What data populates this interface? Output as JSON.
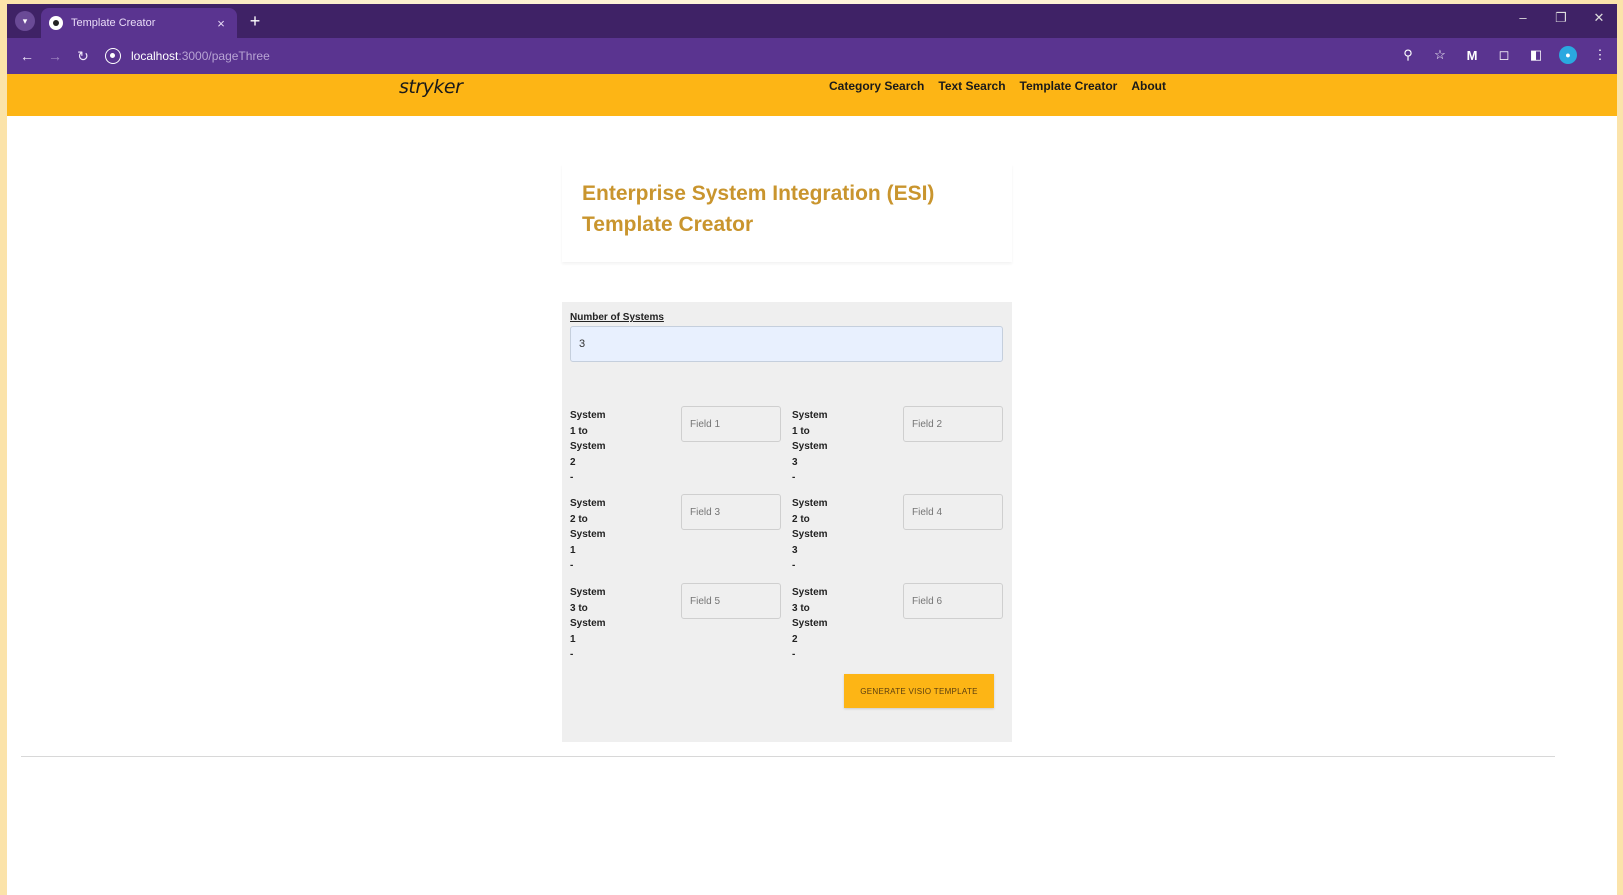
{
  "browser": {
    "tab_title": "Template Creator",
    "tab_close": "×",
    "new_tab": "+",
    "url_host": "localhost",
    "url_path": ":3000/pageThree",
    "window_controls": [
      "–",
      "❐",
      "✕"
    ]
  },
  "header": {
    "logo": "stryker",
    "brand_color": "#fdb515",
    "nav": [
      "Category Search",
      "Text Search",
      "Template Creator",
      "About"
    ]
  },
  "page": {
    "title_line1": "Enterprise System Integration (ESI)",
    "title_line2": "Template Creator",
    "title_color": "#c9952e"
  },
  "form": {
    "systems_label": "Number of Systems",
    "systems_value": "3",
    "pairs": [
      {
        "label": "System\n1 to\nSystem\n2\n-",
        "placeholder": "Field 1"
      },
      {
        "label": "System\n1 to\nSystem\n3\n-",
        "placeholder": "Field 2"
      },
      {
        "label": "System\n2 to\nSystem\n1\n-",
        "placeholder": "Field 3"
      },
      {
        "label": "System\n2 to\nSystem\n3\n-",
        "placeholder": "Field 4"
      },
      {
        "label": "System\n3 to\nSystem\n1\n-",
        "placeholder": "Field 5"
      },
      {
        "label": "System\n3 to\nSystem\n2\n-",
        "placeholder": "Field 6"
      }
    ],
    "generate_label": "GENERATE VISIO TEMPLATE"
  }
}
